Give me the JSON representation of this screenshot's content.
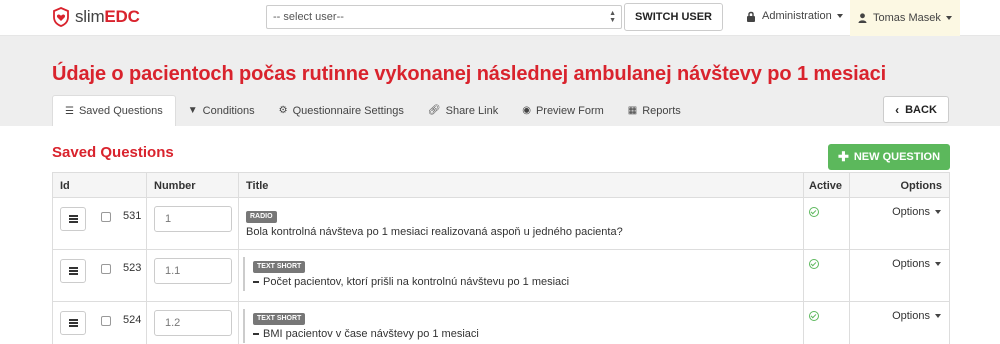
{
  "brand": {
    "name_plain": "slim",
    "name_bold": "EDC",
    "accent": "#d9232d"
  },
  "navbar": {
    "user_select_placeholder": "-- select user--",
    "switch_user": "SWITCH USER",
    "administration": "Administration",
    "user_name": "Tomas Masek"
  },
  "page": {
    "title": "Údaje o pacientoch počas rutinne vykonanej následnej ambulanej návštevy po 1 mesiaci"
  },
  "tabs": [
    {
      "label": "Saved Questions",
      "icon": "list-icon",
      "active": true
    },
    {
      "label": "Conditions",
      "icon": "filter-icon",
      "active": false
    },
    {
      "label": "Questionnaire Settings",
      "icon": "gear-icon",
      "active": false
    },
    {
      "label": "Share Link",
      "icon": "link-icon",
      "active": false
    },
    {
      "label": "Preview Form",
      "icon": "eye-icon",
      "active": false
    },
    {
      "label": "Reports",
      "icon": "table-icon",
      "active": false
    }
  ],
  "back_label": "BACK",
  "section": {
    "title": "Saved Questions",
    "new_question": "NEW QUESTION"
  },
  "table": {
    "headers": {
      "id": "Id",
      "number": "Number",
      "title": "Title",
      "active": "Active",
      "options": "Options"
    },
    "rows": [
      {
        "id": "531",
        "number": "1",
        "type": "RADIO",
        "text": "Bola kontrolná návšteva po 1 mesiaci realizovaná aspoň u jedného pacienta?",
        "nested": false,
        "active": true,
        "options": "Options"
      },
      {
        "id": "523",
        "number": "1.1",
        "type": "TEXT SHORT",
        "text": "Počet pacientov, ktorí prišli na kontrolnú návštevu po 1 mesiaci",
        "nested": true,
        "active": true,
        "options": "Options"
      },
      {
        "id": "524",
        "number": "1.2",
        "type": "TEXT SHORT",
        "text": "BMI pacientov v čase návštevy po 1 mesiaci",
        "nested": true,
        "active": true,
        "options": "Options"
      }
    ]
  },
  "colors": {
    "primary_red": "#d9232d",
    "success_green": "#5cb85c",
    "user_menu_bg": "#fcf8e3"
  }
}
